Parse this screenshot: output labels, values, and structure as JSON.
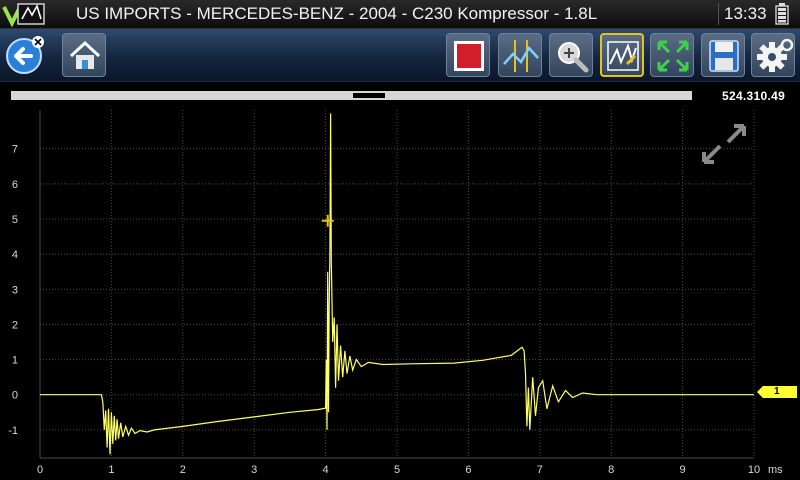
{
  "title_bar": {
    "title": "US IMPORTS - MERCEDES-BENZ - 2004 - C230 Kompressor - 1.8L",
    "time": "13:33"
  },
  "toolbar": {
    "buttons": [
      {
        "name": "back-button",
        "icon": "back-arrow-icon"
      },
      {
        "name": "home-button",
        "icon": "home-icon"
      },
      {
        "name": "stop-record-button",
        "icon": "stop-icon"
      },
      {
        "name": "cursors-button",
        "icon": "cursor-icon"
      },
      {
        "name": "zoom-button",
        "icon": "zoom-icon"
      },
      {
        "name": "trigger-button",
        "icon": "trigger-icon",
        "active": true
      },
      {
        "name": "fullscreen-button",
        "icon": "fullscreen-icon"
      },
      {
        "name": "save-button",
        "icon": "save-icon"
      },
      {
        "name": "settings-button",
        "icon": "gear-icon"
      }
    ]
  },
  "scroll": {
    "timestamp": "524.310.49",
    "position": 0.52
  },
  "colors": {
    "trace": "#ffff66",
    "grid": "#4a4a4a",
    "accent": "#e8c21a"
  },
  "channel": {
    "label": "1"
  },
  "chart_data": {
    "type": "line",
    "xlim": [
      0,
      10
    ],
    "ylim": [
      -1.8,
      8.1
    ],
    "x_ticks": [
      "0",
      "1",
      "2",
      "3",
      "4",
      "5",
      "6",
      "7",
      "8",
      "9",
      "10"
    ],
    "y_ticks": [
      "7",
      "6",
      "5",
      "4",
      "3",
      "2",
      "1",
      "0",
      "-1"
    ],
    "x_unit": "ms",
    "trigger_marker": {
      "x": 4.03,
      "y": 4.95
    },
    "series": [
      {
        "points": [
          [
            0,
            0
          ],
          [
            0.8,
            0
          ],
          [
            0.86,
            0
          ],
          [
            0.88,
            -0.2
          ],
          [
            0.9,
            -1.0
          ],
          [
            0.92,
            -0.45
          ],
          [
            0.94,
            -1.5
          ],
          [
            0.96,
            -0.4
          ],
          [
            0.98,
            -1.7
          ],
          [
            1.0,
            -0.5
          ],
          [
            1.02,
            -1.4
          ],
          [
            1.04,
            -0.6
          ],
          [
            1.06,
            -1.3
          ],
          [
            1.08,
            -0.7
          ],
          [
            1.1,
            -1.25
          ],
          [
            1.13,
            -0.8
          ],
          [
            1.16,
            -1.2
          ],
          [
            1.2,
            -0.9
          ],
          [
            1.24,
            -1.15
          ],
          [
            1.28,
            -0.95
          ],
          [
            1.33,
            -1.1
          ],
          [
            1.4,
            -1.02
          ],
          [
            1.5,
            -1.06
          ],
          [
            1.6,
            -1.0
          ],
          [
            2.0,
            -0.9
          ],
          [
            2.5,
            -0.76
          ],
          [
            3.0,
            -0.63
          ],
          [
            3.5,
            -0.5
          ],
          [
            3.9,
            -0.42
          ],
          [
            4.0,
            -0.38
          ],
          [
            4.01,
            1.0
          ],
          [
            4.02,
            -1.0
          ],
          [
            4.03,
            3.5
          ],
          [
            4.04,
            -0.5
          ],
          [
            4.05,
            2.5
          ],
          [
            4.06,
            4.0
          ],
          [
            4.07,
            8.0
          ],
          [
            4.08,
            3.8
          ],
          [
            4.1,
            1.5
          ],
          [
            4.12,
            2.2
          ],
          [
            4.14,
            0.2
          ],
          [
            4.16,
            2.0
          ],
          [
            4.18,
            0.4
          ],
          [
            4.21,
            1.4
          ],
          [
            4.24,
            0.5
          ],
          [
            4.27,
            1.25
          ],
          [
            4.3,
            0.6
          ],
          [
            4.34,
            1.1
          ],
          [
            4.38,
            0.7
          ],
          [
            4.43,
            1.0
          ],
          [
            4.5,
            0.8
          ],
          [
            4.6,
            0.92
          ],
          [
            4.8,
            0.86
          ],
          [
            5.2,
            0.88
          ],
          [
            5.8,
            0.9
          ],
          [
            6.2,
            0.98
          ],
          [
            6.6,
            1.12
          ],
          [
            6.75,
            1.35
          ],
          [
            6.78,
            1.25
          ],
          [
            6.8,
            0.6
          ],
          [
            6.82,
            -0.9
          ],
          [
            6.84,
            0.2
          ],
          [
            6.86,
            -1.0
          ],
          [
            6.9,
            0.5
          ],
          [
            6.94,
            -0.6
          ],
          [
            6.98,
            0.2
          ],
          [
            7.04,
            0.4
          ],
          [
            7.1,
            -0.4
          ],
          [
            7.18,
            0.25
          ],
          [
            7.26,
            -0.2
          ],
          [
            7.36,
            0.12
          ],
          [
            7.46,
            -0.08
          ],
          [
            7.6,
            0.05
          ],
          [
            7.8,
            0.0
          ],
          [
            8.5,
            0.0
          ],
          [
            10,
            0.0
          ]
        ]
      }
    ]
  }
}
